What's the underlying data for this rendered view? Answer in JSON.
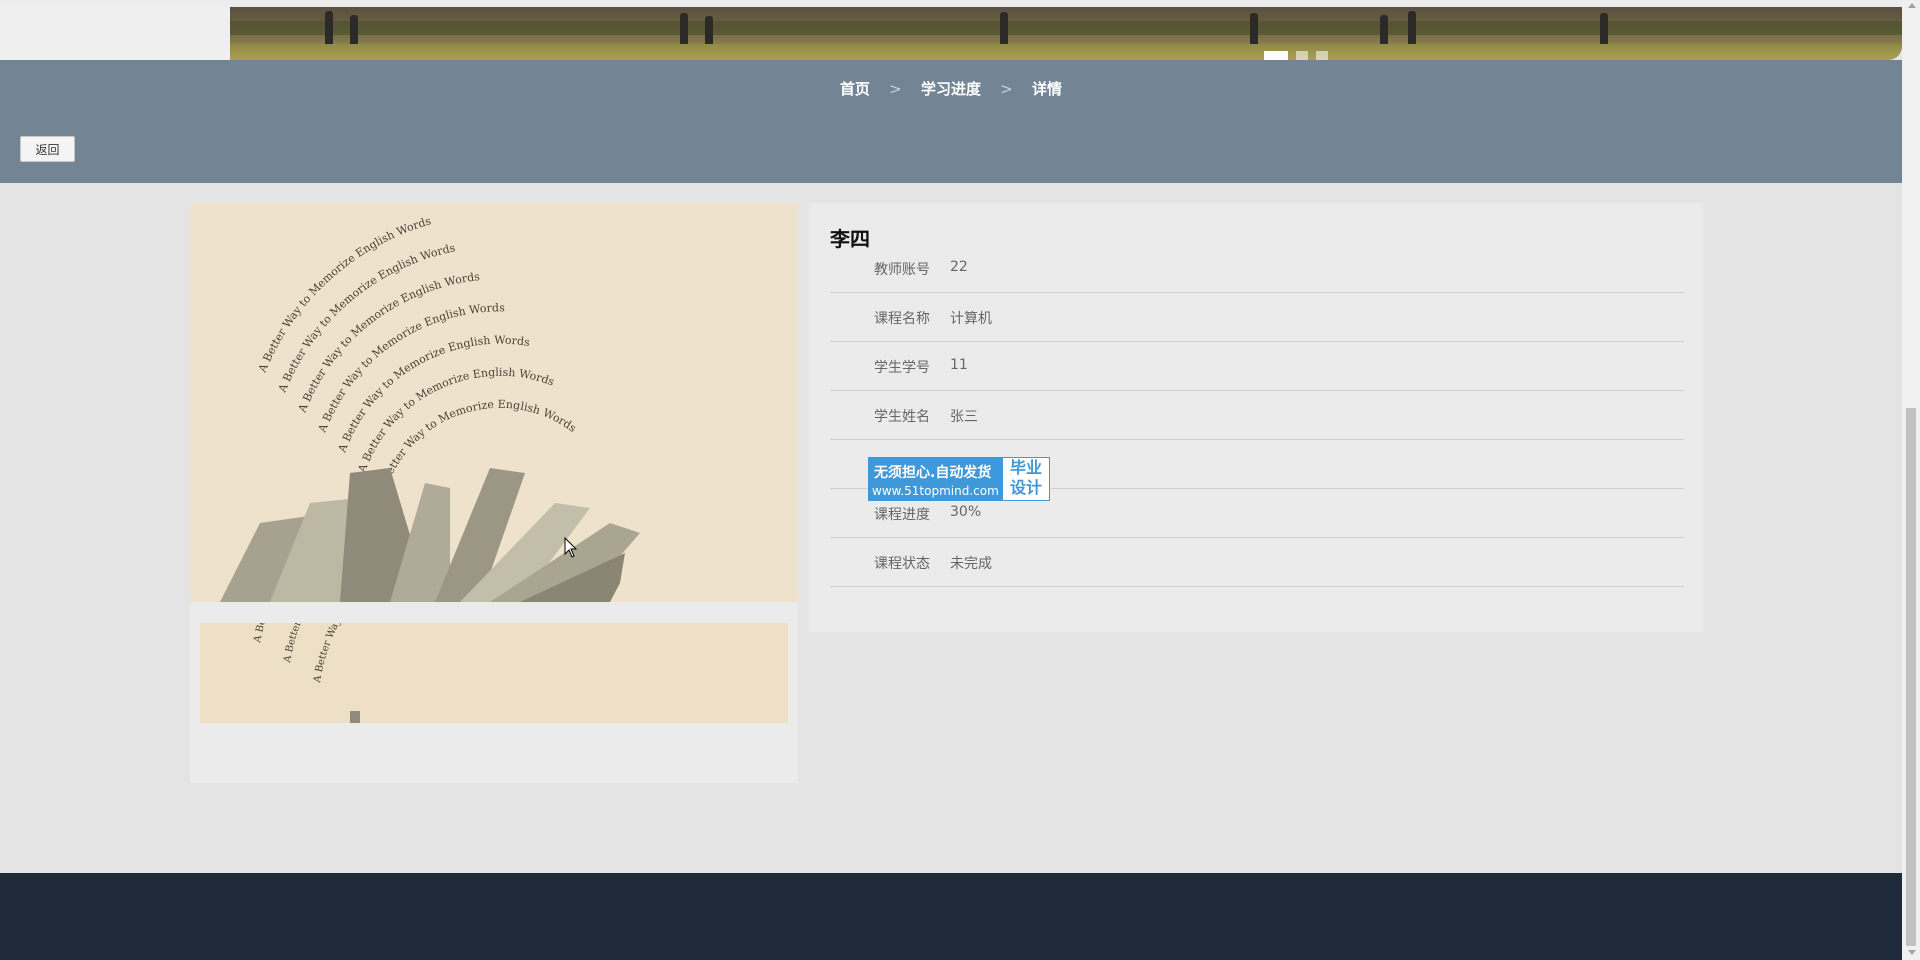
{
  "banner": {
    "carousel_dots": [
      {
        "state": "active"
      },
      {
        "state": "inactive"
      },
      {
        "state": "inactive"
      }
    ]
  },
  "breadcrumb": {
    "home": "首页",
    "progress": "学习进度",
    "current": "详情",
    "separator": ">"
  },
  "actions": {
    "back_label": "返回"
  },
  "gallery": {
    "image_text": "A Better Way to Memorize English Words"
  },
  "detail": {
    "name": "李四",
    "fields": [
      {
        "label": "教师账号",
        "value": "22"
      },
      {
        "label": "课程名称",
        "value": "计算机"
      },
      {
        "label": "学生学号",
        "value": "11"
      },
      {
        "label": "学生姓名",
        "value": "张三"
      },
      {
        "label": "",
        "value": ""
      },
      {
        "label": "课程进度",
        "value": "30%"
      },
      {
        "label": "课程状态",
        "value": "未完成"
      }
    ]
  },
  "ad": {
    "line1": "无须担心.自动发货",
    "line2": "www.51topmind.com",
    "badge_line1": "毕业",
    "badge_line2": "设计"
  },
  "colors": {
    "crumb_bar": "#738594",
    "footer": "#1f2b3a",
    "ad_blue": "#3e98d9"
  },
  "icons": [
    "mouse-pointer-icon",
    "scroll-up-arrow-icon",
    "scroll-down-arrow-icon"
  ]
}
